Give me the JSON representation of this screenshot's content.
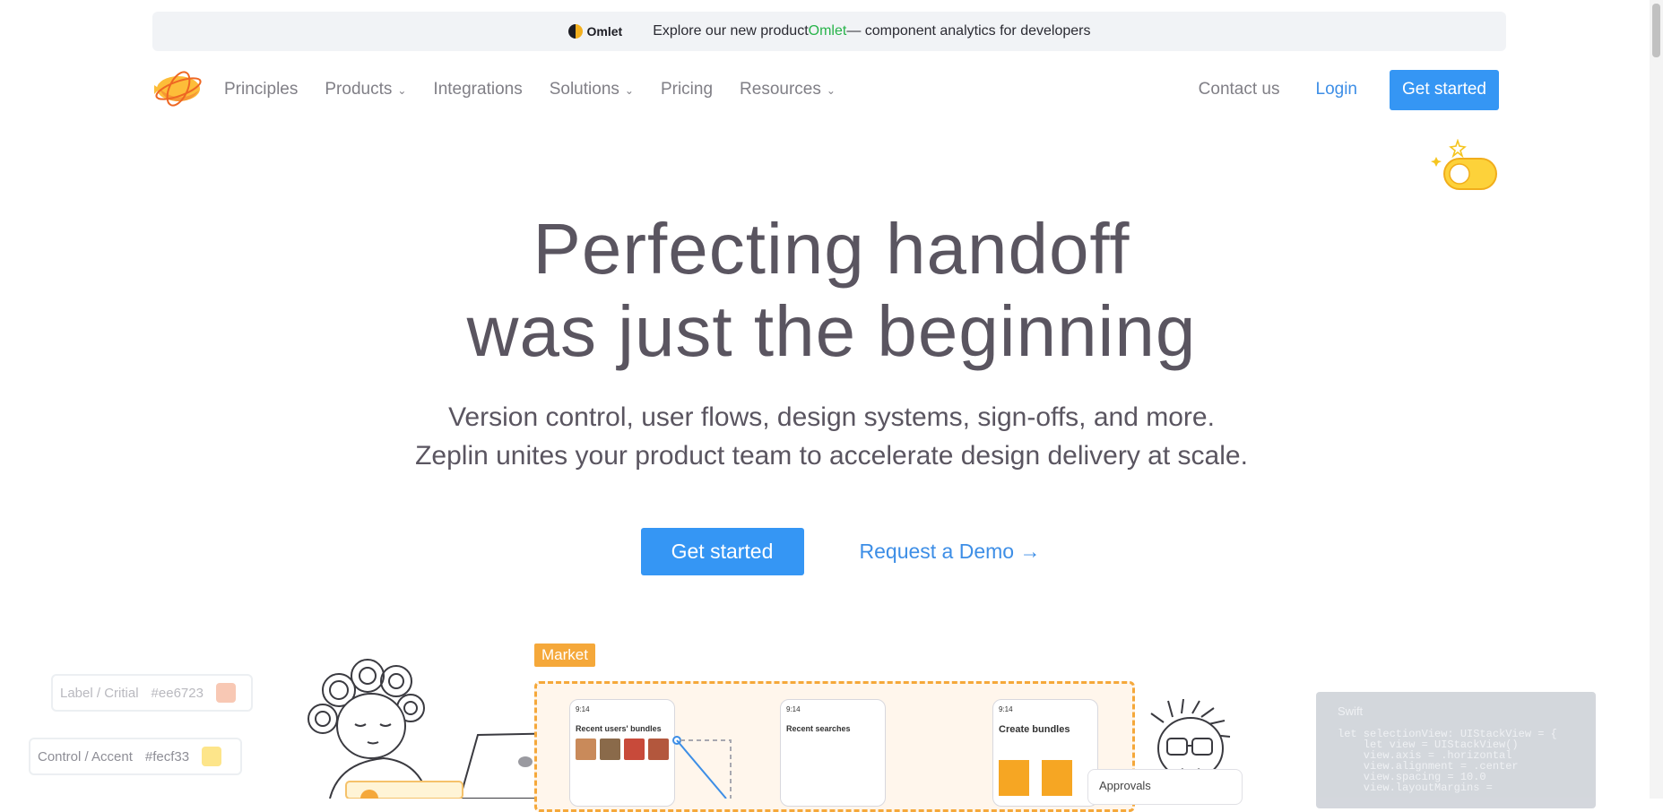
{
  "banner": {
    "brand": "Omlet",
    "text_before": "Explore our new product ",
    "highlight": "Omlet",
    "text_after": " — component analytics for developers"
  },
  "nav": {
    "items": [
      {
        "label": "Principles",
        "dropdown": false
      },
      {
        "label": "Products",
        "dropdown": true
      },
      {
        "label": "Integrations",
        "dropdown": false
      },
      {
        "label": "Solutions",
        "dropdown": true
      },
      {
        "label": "Pricing",
        "dropdown": false
      },
      {
        "label": "Resources",
        "dropdown": true
      }
    ],
    "contact": "Contact us",
    "login": "Login",
    "cta": "Get started"
  },
  "hero": {
    "title_line1": "Perfecting handoff",
    "title_line2": "was just the beginning",
    "sub_line1": "Version control, user flows, design systems, sign-offs, and more.",
    "sub_line2": "Zeplin unites your product team to accelerate design delivery at scale.",
    "primary_cta": "Get started",
    "secondary_cta": "Request a Demo →"
  },
  "illustration": {
    "tokens": [
      {
        "name": "Label / Critial",
        "hex": "#ee6723",
        "color": "#f8c8b4"
      },
      {
        "name": "Control / Accent",
        "hex": "#fecf33",
        "color": "#fde58a"
      }
    ],
    "market_label": "Market",
    "screens": [
      "Recent users' bundles",
      "Recent searches",
      "Create bundles"
    ],
    "screen_time": "9:14",
    "approvals": "Approvals",
    "swift": {
      "title": "Swift",
      "lines": [
        "let selectionView: UIStackView = {",
        "    let view = UIStackView()",
        "    view.axis = .horizontal",
        "    view.alignment = .center",
        "    view.spacing = 10.0",
        "    view.layoutMargins ="
      ]
    }
  },
  "colors": {
    "primary": "#3596f4",
    "link": "#3d8ee6",
    "market_orange": "#f5a83a",
    "omlet_green": "#27b34a"
  }
}
